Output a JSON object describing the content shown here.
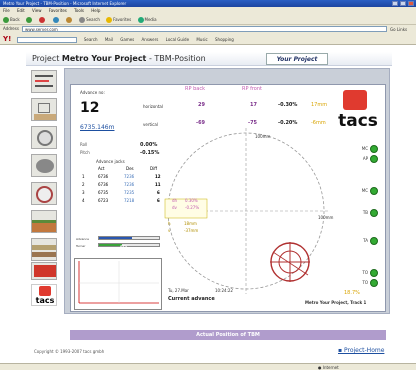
{
  "window": {
    "title": "Metro Your Project - TBM-Position - Microsoft Internet Explorer"
  },
  "menu": [
    "File",
    "Edit",
    "View",
    "Favorites",
    "Tools",
    "Help"
  ],
  "toolbar": {
    "back": "Back",
    "search": "Search",
    "favorites": "Favorites",
    "media": "Media"
  },
  "address": {
    "label": "Address",
    "value": "www.server.com",
    "go": "Go",
    "links": "Links"
  },
  "links_bar": {
    "yahoo": "Y!",
    "search": "Search",
    "items": [
      "Mail",
      "Games",
      "Answers",
      "Local Guide",
      "Music",
      "Shopping"
    ]
  },
  "page": {
    "title_prefix": "Project",
    "title_project": "Metro Your Project",
    "title_suffix": "- TBM-Position",
    "logo_text": "Your Project"
  },
  "sidebar": {
    "tacs_label": "tacs"
  },
  "advance": {
    "label": "Advance no:",
    "value": "12",
    "distance": "6735.146m",
    "rp_back": "RP back",
    "rp_front": "RP front",
    "horizontal_label": "horizontal",
    "vertical_label": "vertical",
    "h_back": "29",
    "h_front": "17",
    "h_pct": "-0.30%",
    "h_mm": "17mm",
    "v_back": "-69",
    "v_front": "-75",
    "v_pct": "-0.20%",
    "v_mm": "-6mm",
    "roll_label": "Roll",
    "roll_value": "0.00%",
    "pitch_label": "Pitch",
    "pitch_value": "-0.15%"
  },
  "jacks": {
    "title": "Advance jacks",
    "headers": [
      "Act",
      "Des",
      "Diff"
    ],
    "rows": [
      [
        "1",
        "6736",
        "7236",
        "12"
      ],
      [
        "2",
        "6736",
        "7236",
        "11"
      ],
      [
        "3",
        "6735",
        "7235",
        "6"
      ],
      [
        "4",
        "6723",
        "7218",
        "6"
      ]
    ]
  },
  "bars": {
    "advance_label": "Advance",
    "turner_label": "Turner",
    "advance_level": 0.55,
    "turner_level": 0.38,
    "turner_pct": "23%"
  },
  "plot_labels": {
    "top": "100mm",
    "right": "100mm",
    "dh_label": "dh",
    "dh_value": "0.30%",
    "dv_label": "dv",
    "dv_value": "-0.27%",
    "h_label": "h",
    "h_value": "18mm",
    "v_label": "v",
    "v_value": "-37mm"
  },
  "indicators": {
    "labels": [
      "MC",
      "AP",
      "MC",
      "TB",
      "TA",
      "TO",
      "TO"
    ],
    "extra": "18.7%"
  },
  "time": {
    "date": "Tu, 27.Mar",
    "clock": "10:24:22",
    "current_advance": "Current advance",
    "caption": "Metro Your Project, Track 1"
  },
  "footer": {
    "bar_text": "Actual Position of TBM",
    "copyright": "Copyright © 1993-2007 tacs gmbh",
    "project_home": "Project-Home"
  },
  "status": {
    "zone": "Internet"
  }
}
